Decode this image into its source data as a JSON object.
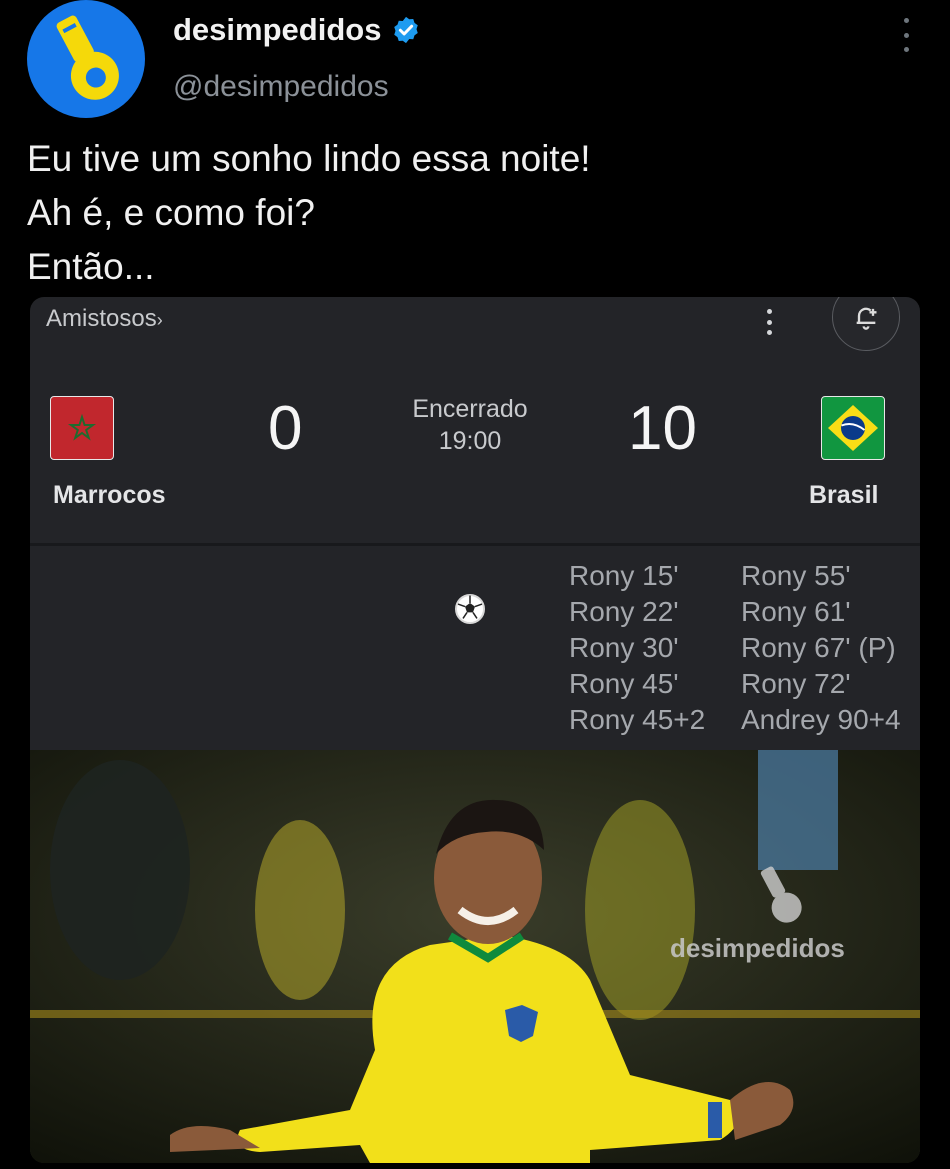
{
  "account": {
    "display_name": "desimpedidos",
    "handle": "@desimpedidos",
    "avatar_icon": "whistle-icon",
    "verified_icon": "verified-badge-icon",
    "accent_color": "#1677e8"
  },
  "tweet": {
    "lines": [
      "Eu tive um sonho lindo essa noite!",
      "Ah é, e como foi?",
      "Então..."
    ]
  },
  "match": {
    "competition": "Amistosos",
    "status": "Encerrado",
    "time": "19:00",
    "home": {
      "name": "Marrocos",
      "score": "0",
      "flag_icon": "morocco-flag-icon"
    },
    "away": {
      "name": "Brasil",
      "score": "10",
      "flag_icon": "brazil-flag-icon"
    },
    "goal_icon": "soccer-ball-icon",
    "scorers_left": [
      "Rony 15'",
      "Rony 22'",
      "Rony 30'",
      "Rony 45'",
      "Rony 45+2"
    ],
    "scorers_right": [
      "Rony 55'",
      "Rony 61'",
      "Rony 67' (P)",
      "Rony 72'",
      "Andrey 90+4"
    ]
  },
  "photo": {
    "watermark": "desimpedidos",
    "watermark_icon": "whistle-icon"
  }
}
